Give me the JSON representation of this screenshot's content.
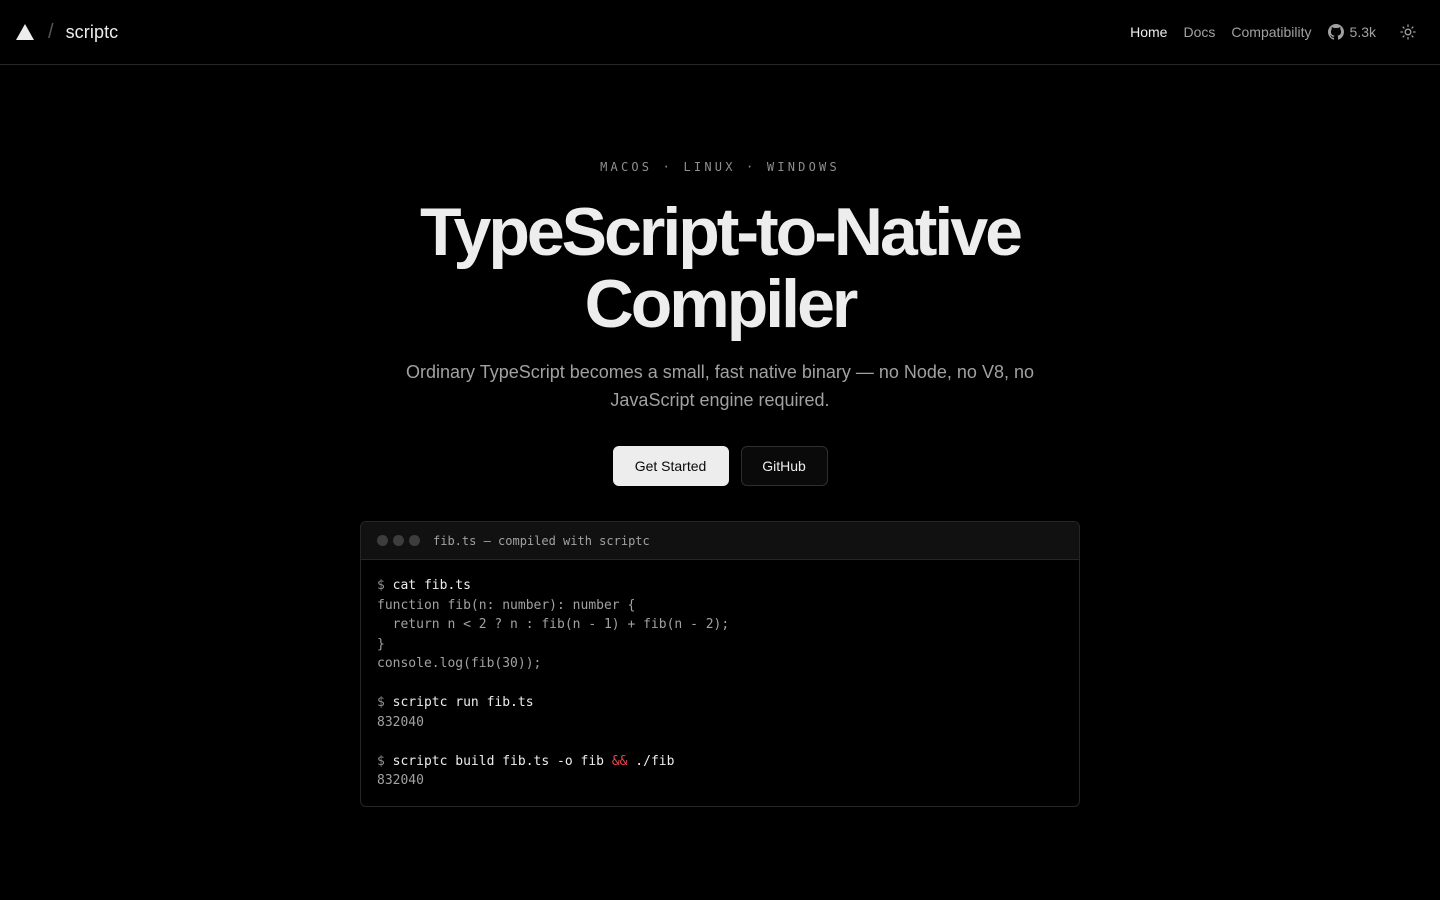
{
  "header": {
    "brand_name": "scriptc",
    "separator": "/",
    "nav": [
      {
        "label": "Home",
        "active": true
      },
      {
        "label": "Docs",
        "active": false
      },
      {
        "label": "Compatibility",
        "active": false
      }
    ],
    "github_stars": "5.3k",
    "icons": {
      "logo": "triangle-logo-icon",
      "github": "github-icon",
      "theme": "sun-icon"
    }
  },
  "hero": {
    "platforms": "MACOS · LINUX · WINDOWS",
    "title_line1": "TypeScript-to-Native",
    "title_line2": "Compiler",
    "subtitle": "Ordinary TypeScript becomes a small, fast native binary — no Node, no V8, no JavaScript engine required.",
    "primary_cta": "Get Started",
    "secondary_cta": "GitHub"
  },
  "terminal": {
    "title": "fib.ts — compiled with scriptc",
    "prompt": "$",
    "cmd1": "cat fib.ts",
    "code": [
      "function fib(n: number): number {",
      "  return n < 2 ? n : fib(n - 1) + fib(n - 2);",
      "}",
      "console.log(fib(30));"
    ],
    "cmd2": "scriptc run fib.ts",
    "out2": "832040",
    "cmd3_a": "scriptc build fib.ts -o fib",
    "cmd3_op": "&&",
    "cmd3_b": "./fib",
    "out3": "832040"
  },
  "colors": {
    "background": "#000000",
    "foreground": "#ededed",
    "muted": "#a1a1a1",
    "accent_operator": "#e5484d"
  }
}
